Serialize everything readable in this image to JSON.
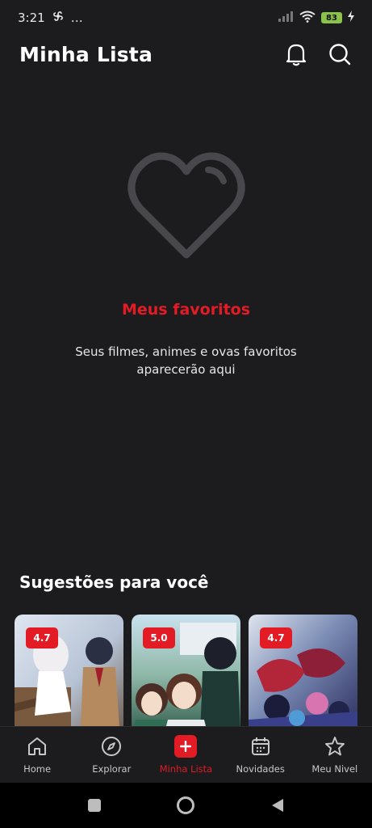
{
  "status_bar": {
    "time": "3:21",
    "extra": "…",
    "battery": "83"
  },
  "header": {
    "title": "Minha Lista",
    "icons": [
      "bell-icon",
      "search-icon"
    ]
  },
  "empty_state": {
    "icon": "heart-outline-icon",
    "title": "Meus favoritos",
    "text": "Seus filmes, animes e ovas favoritos aparecerão aqui"
  },
  "suggestions": {
    "title": "Sugestões para você",
    "cards": [
      {
        "rating": "4.7"
      },
      {
        "rating": "5.0"
      },
      {
        "rating": "4.7"
      }
    ]
  },
  "bottom_nav": {
    "items": [
      {
        "label": "Home",
        "icon": "home-icon"
      },
      {
        "label": "Explorar",
        "icon": "compass-icon"
      },
      {
        "label": "Minha Lista",
        "icon": "add-box-icon"
      },
      {
        "label": "Novidades",
        "icon": "calendar-icon"
      },
      {
        "label": "Meu Nivel",
        "icon": "star-icon"
      }
    ]
  },
  "colors": {
    "background": "#1c1c1f",
    "accent": "#e21b24",
    "heart": "#48484c"
  }
}
